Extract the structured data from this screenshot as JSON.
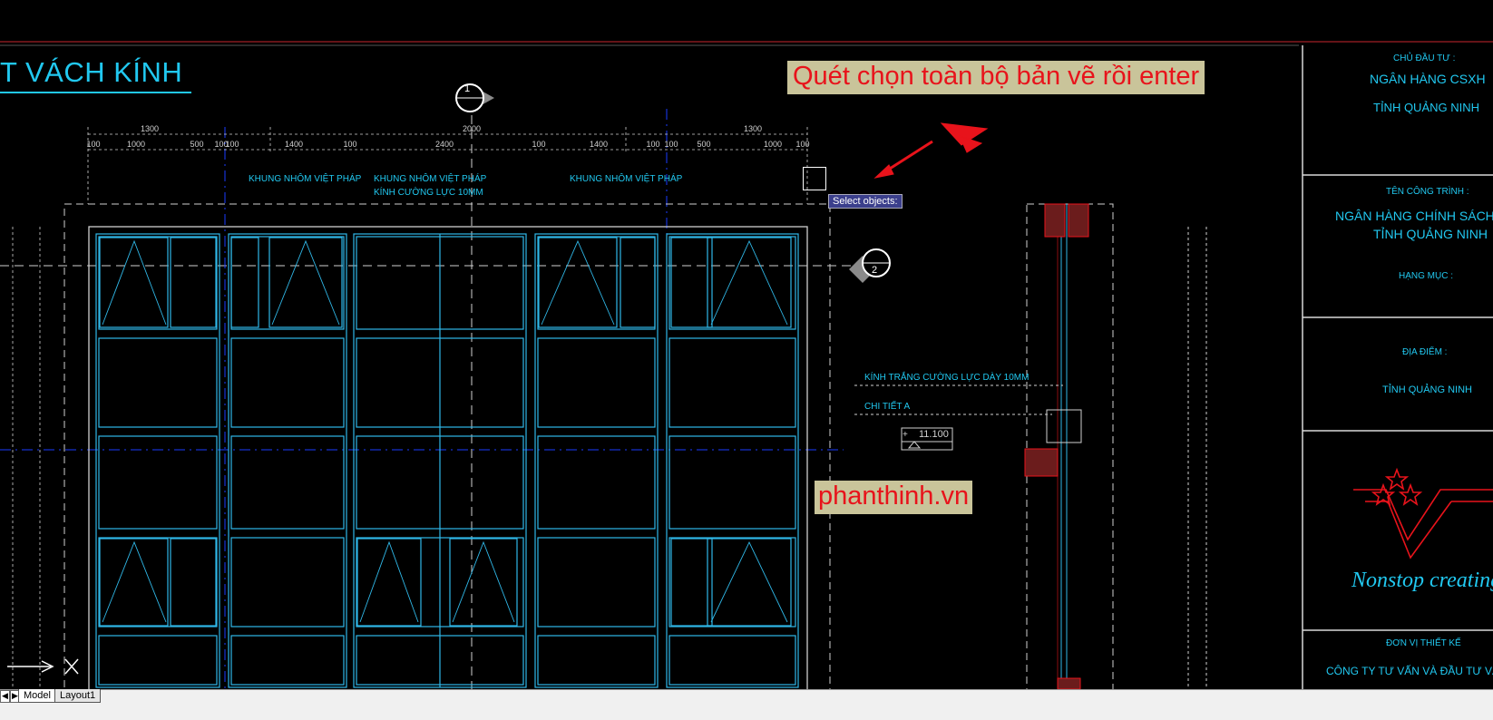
{
  "drawing": {
    "title": "T VÁCH KÍNH",
    "overlay_hint": "Quét chọn toàn bộ bản vẽ rồi enter",
    "watermark": "phanthinh.vn",
    "tooltip": "Select objects:",
    "section_markers": [
      "1",
      "2"
    ],
    "top_dims": [
      "1300",
      "2000",
      "1300"
    ],
    "sub_dims": [
      "100",
      "1000",
      "500",
      "100",
      "100",
      "1400",
      "100",
      "2400",
      "100",
      "1400",
      "100",
      "100",
      "500",
      "1000",
      "100"
    ],
    "annotations": {
      "frame_1": "KHUNG NHÔM VIỆT PHÁP",
      "frame_2": "KHUNG NHÔM VIỆT PHÁP",
      "glass_1": "KÍNH CƯỜNG LỰC 10MM",
      "frame_3": "KHUNG NHÔM VIỆT PHÁP",
      "glass_white": "KÍNH TRẮNG CƯỜNG LỰC DÀY 10MM",
      "detail_a": "CHI TIẾT A",
      "level": "11.100",
      "level_sign": "+"
    }
  },
  "title_block": {
    "owner_label": "CHỦ ĐẦU TƯ :",
    "owner_1": "NGÂN HÀNG CSXH",
    "owner_2": "TỈNH QUẢNG NINH",
    "project_label": "TÊN CÔNG TRÌNH :",
    "project_1": "NGÂN HÀNG CHÍNH SÁCH X",
    "project_2": "TỈNH QUẢNG NINH",
    "item_label": "HẠNG MỤC :",
    "location_label": "ĐỊA ĐIỂM :",
    "location": "TỈNH QUẢNG NINH",
    "slogan": "Nonstop creating",
    "designer_label": "ĐƠN VỊ THIẾT KẾ",
    "designer": "CÔNG TY TƯ VẤN VÀ ĐẦU TƯ VẠN"
  },
  "layout_tabs": [
    "Model",
    "Layout1"
  ],
  "colors": {
    "cyan": "#21c8f0",
    "blue": "#1a3cff",
    "red": "#e8131b",
    "frame": "#30b8e8",
    "bg": "#000000"
  }
}
